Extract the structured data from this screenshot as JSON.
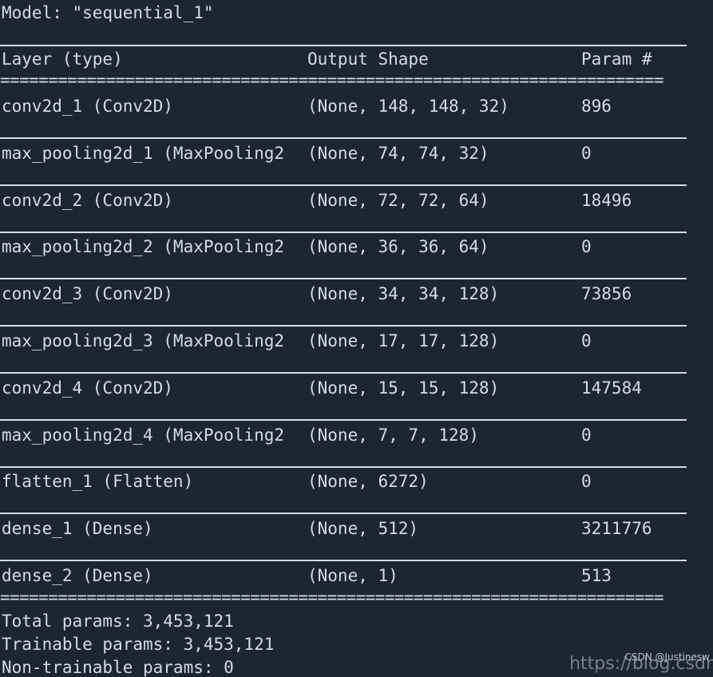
{
  "model": {
    "title": "Model: \"sequential_1\""
  },
  "header": {
    "layer": "Layer (type)",
    "shape": "Output Shape",
    "param": "Param #"
  },
  "separator": "=====================================================================",
  "layers": [
    {
      "layer": "conv2d_1 (Conv2D)",
      "shape": "(None, 148, 148, 32)",
      "param": "896"
    },
    {
      "layer": "max_pooling2d_1 (MaxPooling2",
      "shape": "(None, 74, 74, 32)",
      "param": "0"
    },
    {
      "layer": "conv2d_2 (Conv2D)",
      "shape": "(None, 72, 72, 64)",
      "param": "18496"
    },
    {
      "layer": "max_pooling2d_2 (MaxPooling2",
      "shape": "(None, 36, 36, 64)",
      "param": "0"
    },
    {
      "layer": "conv2d_3 (Conv2D)",
      "shape": "(None, 34, 34, 128)",
      "param": "73856"
    },
    {
      "layer": "max_pooling2d_3 (MaxPooling2",
      "shape": "(None, 17, 17, 128)",
      "param": "0"
    },
    {
      "layer": "conv2d_4 (Conv2D)",
      "shape": "(None, 15, 15, 128)",
      "param": "147584"
    },
    {
      "layer": "max_pooling2d_4 (MaxPooling2",
      "shape": "(None, 7, 7, 128)",
      "param": "0"
    },
    {
      "layer": "flatten_1 (Flatten)",
      "shape": "(None, 6272)",
      "param": "0"
    },
    {
      "layer": "dense_1 (Dense)",
      "shape": "(None, 512)",
      "param": "3211776"
    },
    {
      "layer": "dense_2 (Dense)",
      "shape": "(None, 1)",
      "param": "513"
    }
  ],
  "summary": {
    "total": "Total params: 3,453,121",
    "trainable": "Trainable params: 3,453,121",
    "non_trainable": "Non-trainable params: 0"
  },
  "watermark": {
    "url": "https://blog.csdr",
    "author": "CSDN @Justinesw"
  }
}
